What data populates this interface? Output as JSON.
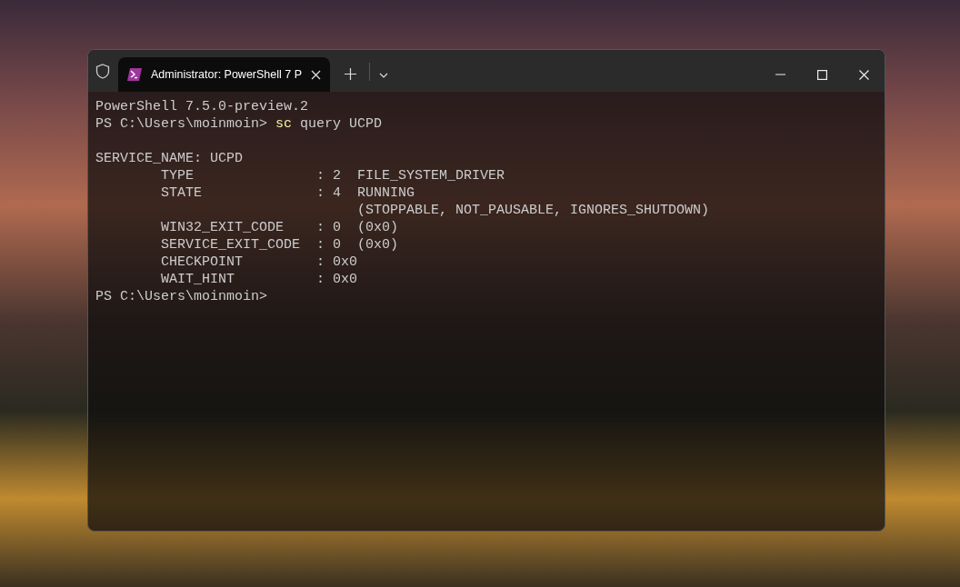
{
  "window": {
    "tab": {
      "title": "Administrator: PowerShell 7 P",
      "selected": true
    }
  },
  "terminal": {
    "lines": [
      {
        "kind": "output",
        "text": "PowerShell 7.5.0-preview.2"
      },
      {
        "kind": "prompt",
        "prompt": "PS C:\\Users\\moinmoin>",
        "command": "sc",
        "args": "query UCPD"
      },
      {
        "kind": "blank"
      },
      {
        "kind": "output",
        "text": "SERVICE_NAME: UCPD"
      },
      {
        "kind": "output",
        "text": "        TYPE               : 2  FILE_SYSTEM_DRIVER"
      },
      {
        "kind": "output",
        "text": "        STATE              : 4  RUNNING"
      },
      {
        "kind": "output",
        "text": "                                (STOPPABLE, NOT_PAUSABLE, IGNORES_SHUTDOWN)"
      },
      {
        "kind": "output",
        "text": "        WIN32_EXIT_CODE    : 0  (0x0)"
      },
      {
        "kind": "output",
        "text": "        SERVICE_EXIT_CODE  : 0  (0x0)"
      },
      {
        "kind": "output",
        "text": "        CHECKPOINT         : 0x0"
      },
      {
        "kind": "output",
        "text": "        WAIT_HINT          : 0x0"
      },
      {
        "kind": "prompt",
        "prompt": "PS C:\\Users\\moinmoin>"
      }
    ]
  }
}
